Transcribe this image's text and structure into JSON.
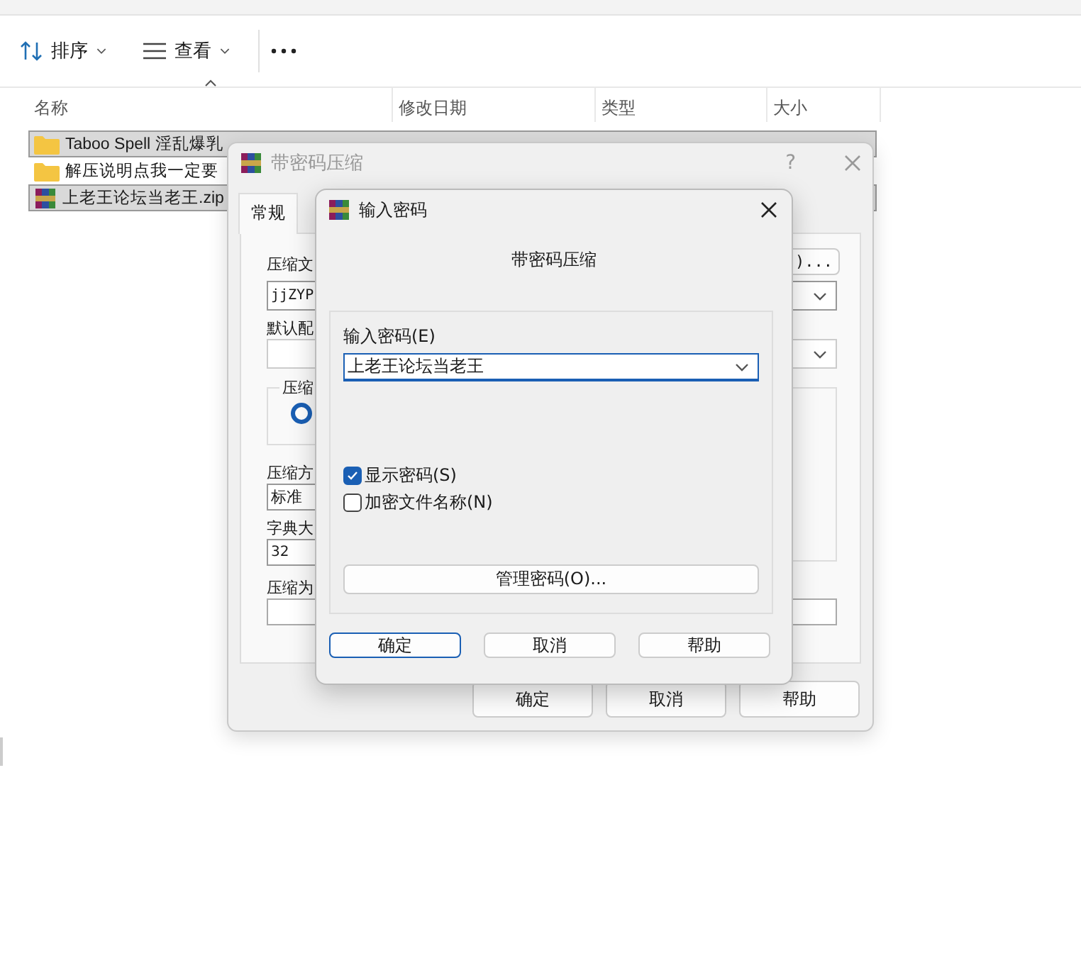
{
  "toolbar": {
    "sort": "排序",
    "view": "查看"
  },
  "columns": [
    "名称",
    "修改日期",
    "类型",
    "大小"
  ],
  "files": [
    {
      "name": "Taboo Spell 淫乱爆乳",
      "kind": "folder",
      "selected": true
    },
    {
      "name": "解压说明点我一定要",
      "kind": "folder",
      "selected": false
    },
    {
      "name": "上老王论坛当老王.zip",
      "kind": "archive",
      "selected": true
    }
  ],
  "archive_dialog": {
    "title": "带密码压缩",
    "help_glyph": "?",
    "tab": "常规",
    "browse_button": ")...",
    "labels": [
      "压缩文",
      "默认配",
      "压缩",
      "压缩方",
      "字典大",
      "压缩为"
    ],
    "archive_name": "jjZYP",
    "radio": {
      "selected": true
    },
    "method": "标准",
    "dictionary": "32",
    "buttons": [
      "确定",
      "取消",
      "帮助"
    ]
  },
  "password_dialog": {
    "title": "输入密码",
    "heading": "带密码压缩",
    "field_label": "输入密码(E)",
    "password": "上老王论坛当老王",
    "options": [
      {
        "label": "显示密码(S)",
        "checked": true
      },
      {
        "label": "加密文件名称(N)",
        "checked": false
      }
    ],
    "manage_button": "管理密码(O)...",
    "buttons": [
      {
        "label": "确定",
        "selected": true
      },
      {
        "label": "取消",
        "selected": false
      },
      {
        "label": "帮助",
        "selected": false
      }
    ]
  }
}
